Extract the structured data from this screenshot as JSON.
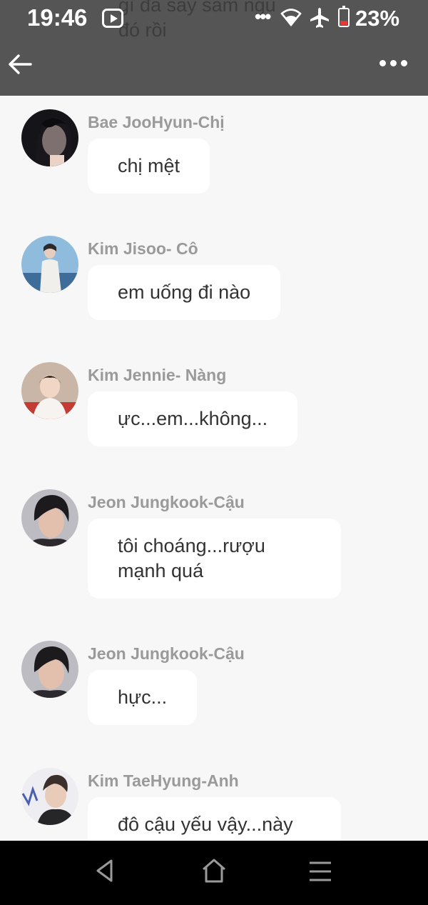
{
  "status_bar": {
    "time": "19:46",
    "battery": "23%",
    "icons": [
      "youtube-icon",
      "more-dots-icon",
      "wifi-icon",
      "airplane-icon",
      "battery-icon"
    ]
  },
  "header": {
    "ghost_text": "gì đã say sấm ngủ\nđó rồi",
    "icons": [
      "back-arrow-icon",
      "more-options-icon"
    ]
  },
  "messages": [
    {
      "sender": "Bae JooHyun-Chị",
      "text": "chị mệt"
    },
    {
      "sender": "Kim Jisoo- Cô",
      "text": "em uống đi nào"
    },
    {
      "sender": "Kim Jennie- Nàng",
      "text": "ực...em...không..."
    },
    {
      "sender": "Jeon Jungkook-Cậu",
      "text": "tôi choáng...rượu\nmạnh quá"
    },
    {
      "sender": "Jeon Jungkook-Cậu",
      "text": "hực..."
    },
    {
      "sender": "Kim TaeHyung-Anh",
      "text": "đô cậu yếu vậy...này"
    }
  ],
  "nav_bar": {
    "icons": [
      "nav-back-icon",
      "nav-home-icon",
      "nav-menu-icon"
    ]
  }
}
